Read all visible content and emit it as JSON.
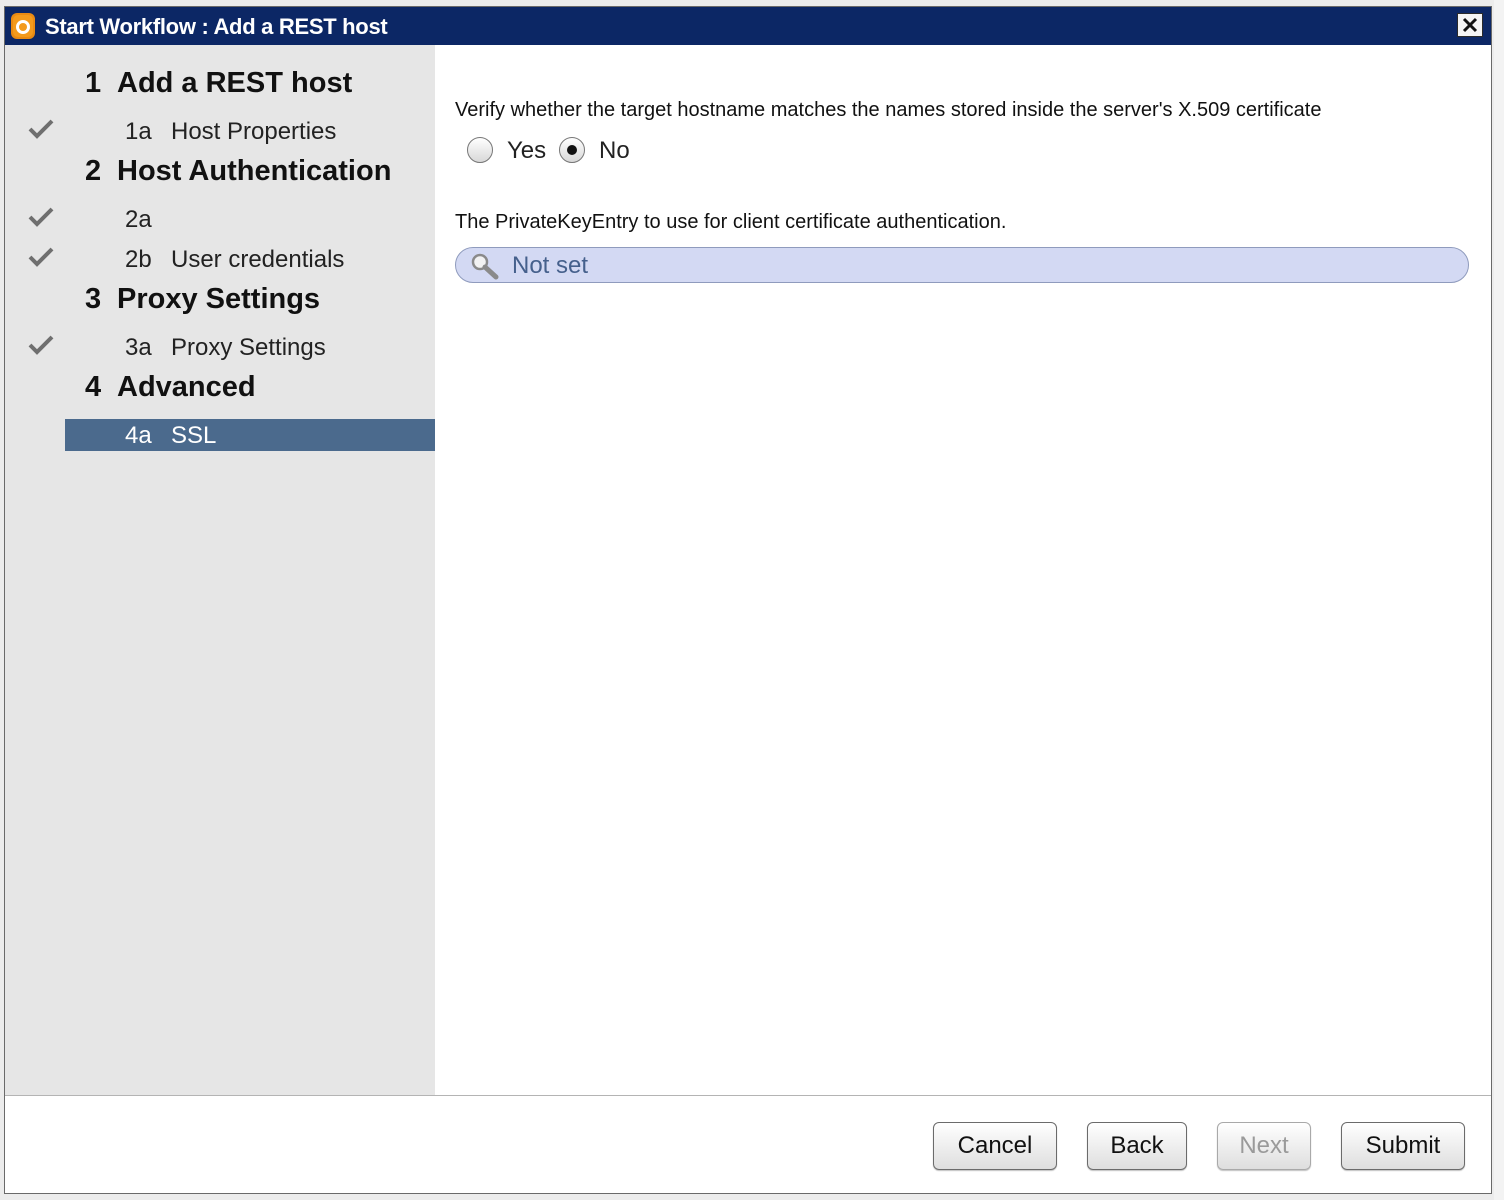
{
  "window": {
    "title": "Start Workflow : Add a REST host",
    "close_label": "close"
  },
  "sidebar": {
    "steps": [
      {
        "number": "1",
        "title": "Add a REST host",
        "substeps": [
          {
            "id": "1a",
            "label": "Host Properties",
            "completed": true,
            "selected": false
          }
        ]
      },
      {
        "number": "2",
        "title": "Host Authentication",
        "substeps": [
          {
            "id": "2a",
            "label": "",
            "completed": true,
            "selected": false
          },
          {
            "id": "2b",
            "label": "User credentials",
            "completed": true,
            "selected": false
          }
        ]
      },
      {
        "number": "3",
        "title": "Proxy Settings",
        "substeps": [
          {
            "id": "3a",
            "label": "Proxy Settings",
            "completed": true,
            "selected": false
          }
        ]
      },
      {
        "number": "4",
        "title": "Advanced",
        "substeps": [
          {
            "id": "4a",
            "label": "SSL",
            "completed": false,
            "selected": true
          }
        ]
      }
    ]
  },
  "content": {
    "verify_label": "Verify whether the target hostname matches the names stored inside the server's X.509 certificate",
    "verify_options": [
      "Yes",
      "No"
    ],
    "verify_selected": "No",
    "keyentry_label": "The PrivateKeyEntry to use for client certificate authentication.",
    "keyentry_value": "Not set"
  },
  "footer": {
    "cancel": "Cancel",
    "back": "Back",
    "next": "Next",
    "next_enabled": false,
    "submit": "Submit"
  },
  "colors": {
    "titlebar": "#0c2765",
    "sidebar_bg": "#e6e6e6",
    "selected_bg": "#4b6a8d",
    "picker_bg": "#d3d9f3",
    "picker_text": "#45608c"
  },
  "icons": {
    "app": "orchestrator-app-icon",
    "close": "close-icon",
    "check": "check-icon",
    "search": "magnifier-icon"
  }
}
